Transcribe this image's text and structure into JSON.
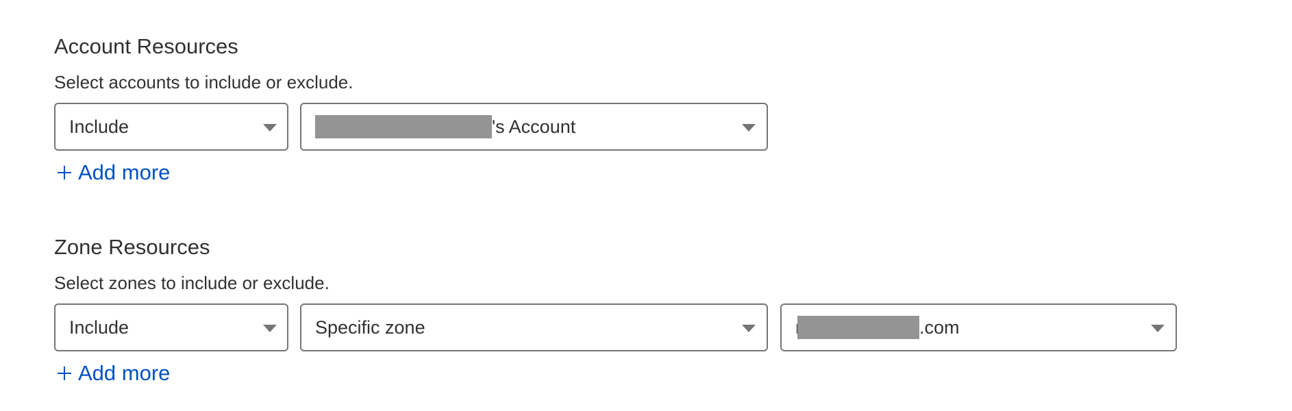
{
  "account_resources": {
    "title": "Account Resources",
    "description": "Select accounts to include or exclude.",
    "rows": [
      {
        "mode": {
          "value": "Include",
          "icon": "caret-down-icon"
        },
        "account": {
          "value_suffix": "'s Account",
          "redacted": true,
          "icon": "caret-down-icon"
        }
      }
    ],
    "add_more_label": "Add more",
    "add_more_icon": "plus-icon"
  },
  "zone_resources": {
    "title": "Zone Resources",
    "description": "Select zones to include or exclude.",
    "rows": [
      {
        "mode": {
          "value": "Include",
          "icon": "caret-down-icon"
        },
        "scope": {
          "value": "Specific zone",
          "icon": "caret-down-icon"
        },
        "zone": {
          "value_prefix": "r",
          "value_suffix": ".com",
          "redacted": true,
          "icon": "caret-down-icon"
        }
      }
    ],
    "add_more_label": "Add more",
    "add_more_icon": "plus-icon"
  },
  "colors": {
    "link": "#0051c3",
    "text": "#313131",
    "border": "#757575",
    "redaction": "#949494"
  }
}
